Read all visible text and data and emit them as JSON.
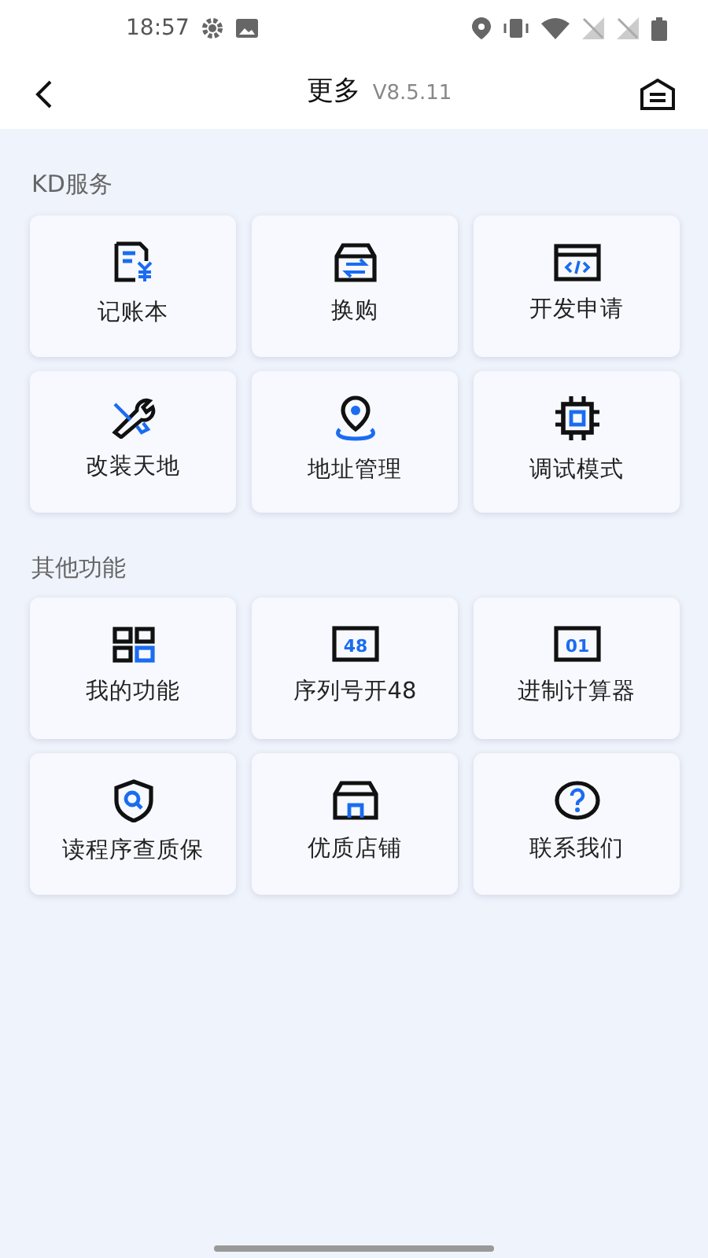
{
  "status_bar": {
    "time": "18:57"
  },
  "header": {
    "title": "更多",
    "version": "V8.5.11"
  },
  "sections": [
    {
      "title": "KD服务",
      "items": [
        {
          "label": "记账本",
          "kind": "ledger"
        },
        {
          "label": "换购",
          "kind": "exchange"
        },
        {
          "label": "开发申请",
          "kind": "code"
        },
        {
          "label": "改装天地",
          "kind": "tools"
        },
        {
          "label": "地址管理",
          "kind": "location"
        },
        {
          "label": "调试模式",
          "kind": "chip"
        }
      ]
    },
    {
      "title": "其他功能",
      "items": [
        {
          "label": "我的功能",
          "kind": "grid"
        },
        {
          "label": "序列号开48",
          "kind": "badge",
          "icon_text": "48"
        },
        {
          "label": "进制计算器",
          "kind": "badge",
          "icon_text": "01"
        },
        {
          "label": "读程序查质保",
          "kind": "shield"
        },
        {
          "label": "优质店铺",
          "kind": "store"
        },
        {
          "label": "联系我们",
          "kind": "help"
        }
      ]
    }
  ]
}
